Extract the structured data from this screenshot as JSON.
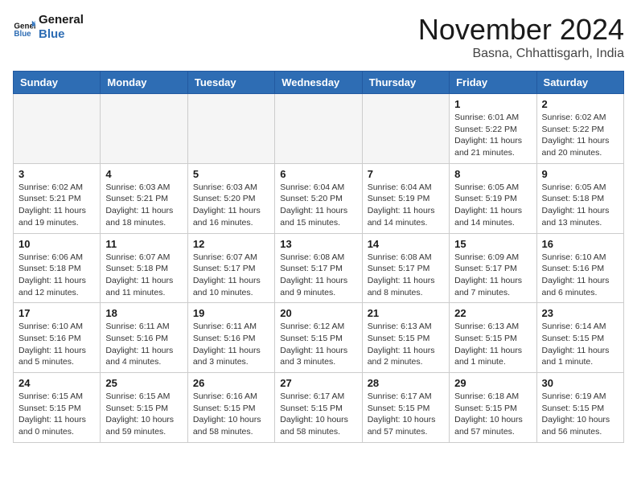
{
  "header": {
    "logo_line1": "General",
    "logo_line2": "Blue",
    "month": "November 2024",
    "location": "Basna, Chhattisgarh, India"
  },
  "weekdays": [
    "Sunday",
    "Monday",
    "Tuesday",
    "Wednesday",
    "Thursday",
    "Friday",
    "Saturday"
  ],
  "weeks": [
    [
      {
        "day": "",
        "text": ""
      },
      {
        "day": "",
        "text": ""
      },
      {
        "day": "",
        "text": ""
      },
      {
        "day": "",
        "text": ""
      },
      {
        "day": "",
        "text": ""
      },
      {
        "day": "1",
        "text": "Sunrise: 6:01 AM\nSunset: 5:22 PM\nDaylight: 11 hours and 21 minutes."
      },
      {
        "day": "2",
        "text": "Sunrise: 6:02 AM\nSunset: 5:22 PM\nDaylight: 11 hours and 20 minutes."
      }
    ],
    [
      {
        "day": "3",
        "text": "Sunrise: 6:02 AM\nSunset: 5:21 PM\nDaylight: 11 hours and 19 minutes."
      },
      {
        "day": "4",
        "text": "Sunrise: 6:03 AM\nSunset: 5:21 PM\nDaylight: 11 hours and 18 minutes."
      },
      {
        "day": "5",
        "text": "Sunrise: 6:03 AM\nSunset: 5:20 PM\nDaylight: 11 hours and 16 minutes."
      },
      {
        "day": "6",
        "text": "Sunrise: 6:04 AM\nSunset: 5:20 PM\nDaylight: 11 hours and 15 minutes."
      },
      {
        "day": "7",
        "text": "Sunrise: 6:04 AM\nSunset: 5:19 PM\nDaylight: 11 hours and 14 minutes."
      },
      {
        "day": "8",
        "text": "Sunrise: 6:05 AM\nSunset: 5:19 PM\nDaylight: 11 hours and 14 minutes."
      },
      {
        "day": "9",
        "text": "Sunrise: 6:05 AM\nSunset: 5:18 PM\nDaylight: 11 hours and 13 minutes."
      }
    ],
    [
      {
        "day": "10",
        "text": "Sunrise: 6:06 AM\nSunset: 5:18 PM\nDaylight: 11 hours and 12 minutes."
      },
      {
        "day": "11",
        "text": "Sunrise: 6:07 AM\nSunset: 5:18 PM\nDaylight: 11 hours and 11 minutes."
      },
      {
        "day": "12",
        "text": "Sunrise: 6:07 AM\nSunset: 5:17 PM\nDaylight: 11 hours and 10 minutes."
      },
      {
        "day": "13",
        "text": "Sunrise: 6:08 AM\nSunset: 5:17 PM\nDaylight: 11 hours and 9 minutes."
      },
      {
        "day": "14",
        "text": "Sunrise: 6:08 AM\nSunset: 5:17 PM\nDaylight: 11 hours and 8 minutes."
      },
      {
        "day": "15",
        "text": "Sunrise: 6:09 AM\nSunset: 5:17 PM\nDaylight: 11 hours and 7 minutes."
      },
      {
        "day": "16",
        "text": "Sunrise: 6:10 AM\nSunset: 5:16 PM\nDaylight: 11 hours and 6 minutes."
      }
    ],
    [
      {
        "day": "17",
        "text": "Sunrise: 6:10 AM\nSunset: 5:16 PM\nDaylight: 11 hours and 5 minutes."
      },
      {
        "day": "18",
        "text": "Sunrise: 6:11 AM\nSunset: 5:16 PM\nDaylight: 11 hours and 4 minutes."
      },
      {
        "day": "19",
        "text": "Sunrise: 6:11 AM\nSunset: 5:16 PM\nDaylight: 11 hours and 3 minutes."
      },
      {
        "day": "20",
        "text": "Sunrise: 6:12 AM\nSunset: 5:15 PM\nDaylight: 11 hours and 3 minutes."
      },
      {
        "day": "21",
        "text": "Sunrise: 6:13 AM\nSunset: 5:15 PM\nDaylight: 11 hours and 2 minutes."
      },
      {
        "day": "22",
        "text": "Sunrise: 6:13 AM\nSunset: 5:15 PM\nDaylight: 11 hours and 1 minute."
      },
      {
        "day": "23",
        "text": "Sunrise: 6:14 AM\nSunset: 5:15 PM\nDaylight: 11 hours and 1 minute."
      }
    ],
    [
      {
        "day": "24",
        "text": "Sunrise: 6:15 AM\nSunset: 5:15 PM\nDaylight: 11 hours and 0 minutes."
      },
      {
        "day": "25",
        "text": "Sunrise: 6:15 AM\nSunset: 5:15 PM\nDaylight: 10 hours and 59 minutes."
      },
      {
        "day": "26",
        "text": "Sunrise: 6:16 AM\nSunset: 5:15 PM\nDaylight: 10 hours and 58 minutes."
      },
      {
        "day": "27",
        "text": "Sunrise: 6:17 AM\nSunset: 5:15 PM\nDaylight: 10 hours and 58 minutes."
      },
      {
        "day": "28",
        "text": "Sunrise: 6:17 AM\nSunset: 5:15 PM\nDaylight: 10 hours and 57 minutes."
      },
      {
        "day": "29",
        "text": "Sunrise: 6:18 AM\nSunset: 5:15 PM\nDaylight: 10 hours and 57 minutes."
      },
      {
        "day": "30",
        "text": "Sunrise: 6:19 AM\nSunset: 5:15 PM\nDaylight: 10 hours and 56 minutes."
      }
    ]
  ]
}
